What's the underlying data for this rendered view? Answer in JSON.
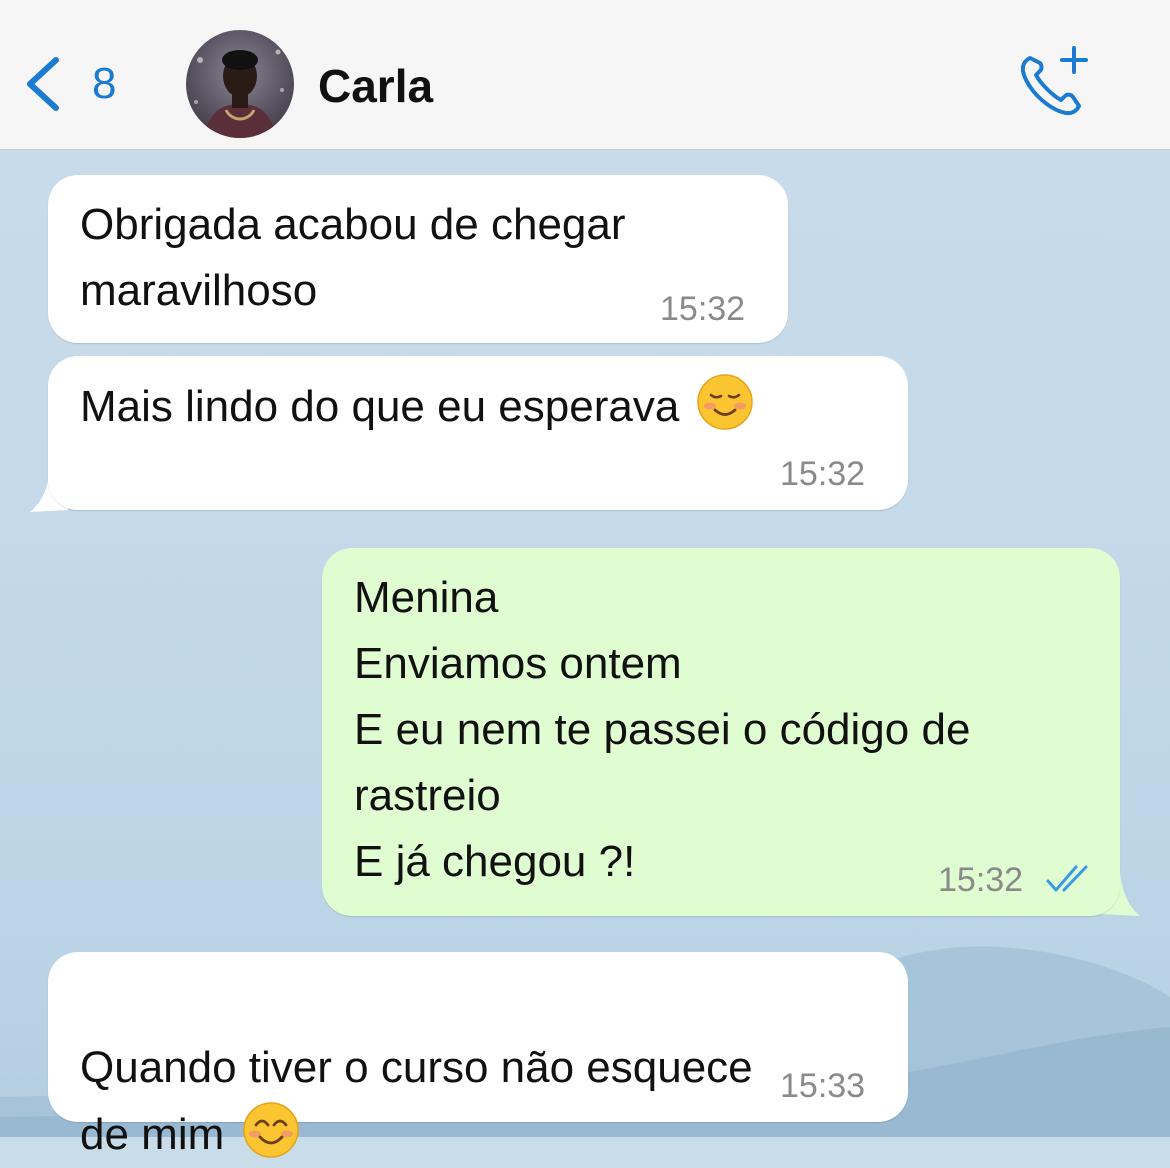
{
  "header": {
    "unread_count": "8",
    "contact_name": "Carla"
  },
  "colors": {
    "accent": "#1a7bd0",
    "incoming_bubble": "#ffffff",
    "outgoing_bubble": "#e0fcd1",
    "read_receipt": "#3a9ae8"
  },
  "messages": [
    {
      "direction": "incoming",
      "text": "Obrigada acabou de chegar\nmaravilhoso",
      "time": "15:32"
    },
    {
      "direction": "incoming",
      "text": "Mais lindo do que eu esperava",
      "emoji": "smiling-face-icon",
      "time": "15:32"
    },
    {
      "direction": "outgoing",
      "text": "Menina\nEnviamos ontem\nE eu nem te passei o código de\nrastreio\nE já chegou ?!",
      "time": "15:32",
      "status": "read"
    },
    {
      "direction": "incoming",
      "text": "Quando tiver o curso não esquece\nde mim",
      "emoji": "smiling-face-with-smiling-eyes-icon",
      "time": "15:33"
    }
  ]
}
